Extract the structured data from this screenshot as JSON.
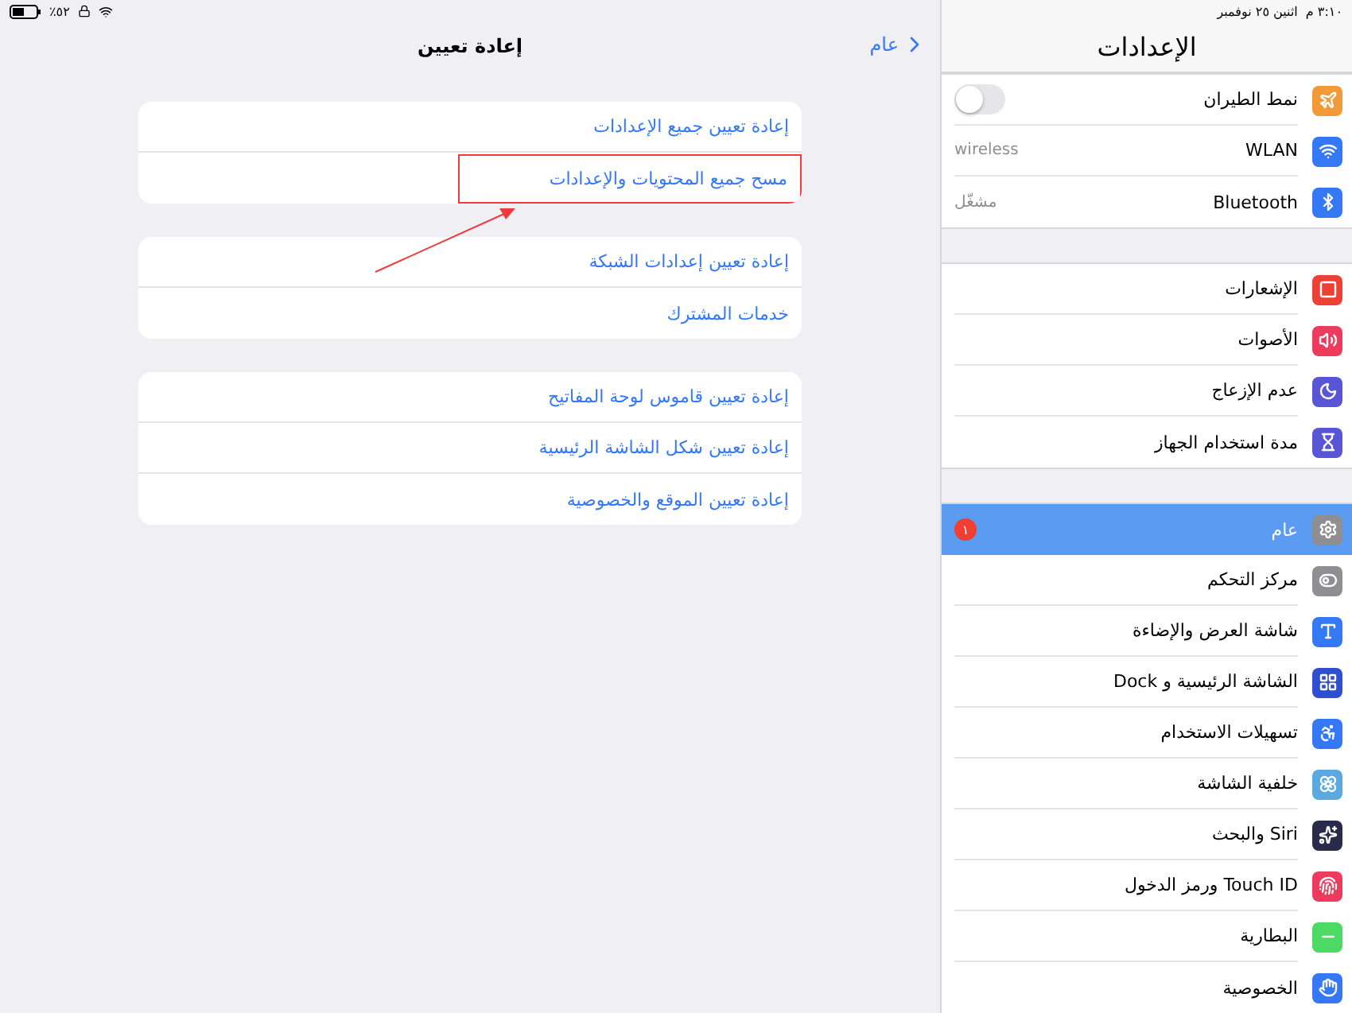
{
  "status_bar": {
    "time": "٣:١٠ م",
    "date": "اثنين ٢٥ نوفمبر",
    "battery": "٪٥٢"
  },
  "sidebar": {
    "title": "الإعدادات",
    "groups": [
      {
        "items": [
          {
            "label": "نمط الطيران",
            "kind": "toggle",
            "on": false,
            "color": "#f19a37",
            "selected": false
          },
          {
            "label": "WLAN",
            "kind": "value",
            "value": "wireless",
            "color": "#3478f6",
            "selected": false
          },
          {
            "label": "Bluetooth",
            "kind": "value",
            "value": "مشغّل",
            "color": "#3478f6",
            "selected": false
          }
        ]
      },
      {
        "items": [
          {
            "label": "الإشعارات",
            "kind": "plain",
            "color": "#ee4136",
            "selected": false
          },
          {
            "label": "الأصوات",
            "kind": "plain",
            "color": "#ee3a5c",
            "selected": false
          },
          {
            "label": "عدم الإزعاج",
            "kind": "plain",
            "color": "#5856d6",
            "selected": false
          },
          {
            "label": "مدة استخدام الجهاز",
            "kind": "plain",
            "color": "#5856d6",
            "selected": false
          }
        ]
      },
      {
        "items": [
          {
            "label": "عام",
            "kind": "badge",
            "badge": "١",
            "color": "#8e8e93",
            "selected": true
          },
          {
            "label": "مركز التحكم",
            "kind": "plain",
            "color": "#8e8e93",
            "selected": false
          },
          {
            "label": "شاشة العرض والإضاءة",
            "kind": "plain",
            "color": "#3478f6",
            "selected": false
          },
          {
            "label": "الشاشة الرئيسية و Dock",
            "kind": "plain",
            "color": "#2f4fd0",
            "selected": false
          },
          {
            "label": "تسهيلات الاستخدام",
            "kind": "plain",
            "color": "#3478f6",
            "selected": false
          },
          {
            "label": "خلفية الشاشة",
            "kind": "plain",
            "color": "#5aa9e0",
            "selected": false
          },
          {
            "label": "Siri والبحث",
            "kind": "plain",
            "color": "#2a2a4a",
            "selected": false
          },
          {
            "label": "Touch ID ورمز الدخول",
            "kind": "plain",
            "color": "#ee3a5c",
            "selected": false
          },
          {
            "label": "البطارية",
            "kind": "plain",
            "color": "#4cd964",
            "selected": false
          },
          {
            "label": "الخصوصية",
            "kind": "plain",
            "color": "#3478f6",
            "selected": false
          }
        ]
      }
    ]
  },
  "detail": {
    "title": "إعادة تعيين",
    "back": "عام",
    "groups": [
      {
        "items": [
          {
            "label": "إعادة تعيين جميع الإعدادات",
            "highlighted": false
          },
          {
            "label": "مسح جميع المحتويات والإعدادات",
            "highlighted": true
          }
        ]
      },
      {
        "items": [
          {
            "label": "إعادة تعيين إعدادات الشبكة",
            "highlighted": false
          },
          {
            "label": "خدمات المشترك",
            "highlighted": false
          }
        ]
      },
      {
        "items": [
          {
            "label": "إعادة تعيين قاموس لوحة المفاتيح",
            "highlighted": false
          },
          {
            "label": "إعادة تعيين شكل الشاشة الرئيسية",
            "highlighted": false
          },
          {
            "label": "إعادة تعيين الموقع والخصوصية",
            "highlighted": false
          }
        ]
      }
    ]
  }
}
